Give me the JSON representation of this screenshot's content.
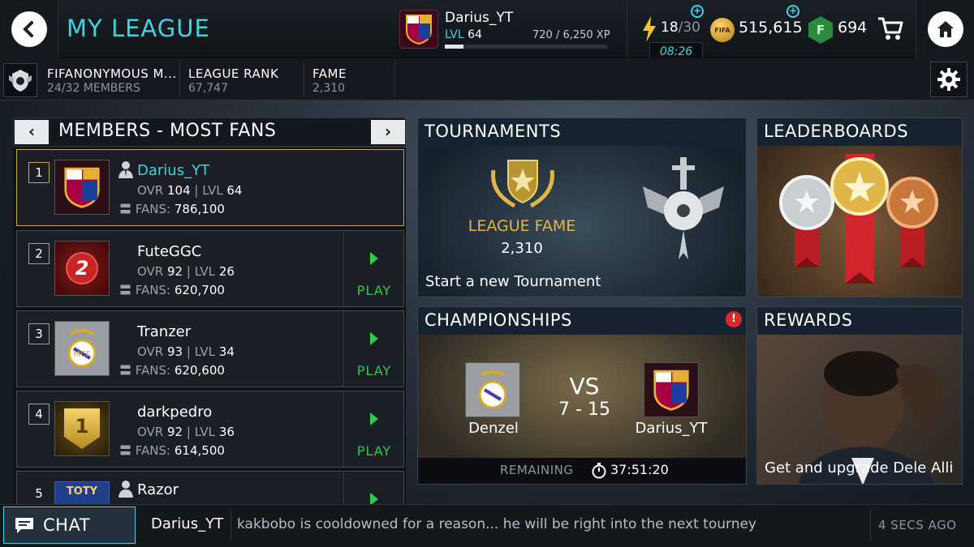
{
  "header": {
    "title": "MY LEAGUE",
    "profile": {
      "name": "Darius_YT",
      "level_label": "LVL",
      "level": "64",
      "xp": "720 / 6,250 XP",
      "xp_progress": 0.115
    },
    "energy": {
      "value": "18",
      "max": "/30",
      "timer": "08:26"
    },
    "coins": "515,615",
    "coin_icon_text": "FIFA",
    "points_icon_text": "F",
    "points": "694",
    "icons": [
      "back-icon",
      "bolt-icon",
      "coin-icon",
      "fifa-points-icon",
      "cart-icon",
      "home-icon",
      "plus-icon"
    ]
  },
  "league": {
    "name": "FIFANONYMOUS M...",
    "members": "24/32 MEMBERS",
    "rank_label": "LEAGUE RANK",
    "rank": "67,747",
    "fame_label": "FAME",
    "fame": "2,310"
  },
  "members_panel": {
    "title": "MEMBERS - MOST FANS",
    "prev": "‹",
    "next": "›",
    "ovr_label": "OVR",
    "lvl_label": "LVL",
    "fans_label": "FANS:",
    "play_label": "PLAY",
    "members": [
      {
        "rank": "1",
        "name": "Darius_YT",
        "ovr": "104",
        "lvl": "64",
        "fans": "786,100",
        "is_self": true
      },
      {
        "rank": "2",
        "name": "FuteGGC",
        "ovr": "92",
        "lvl": "26",
        "fans": "620,700",
        "badge_text": "2"
      },
      {
        "rank": "3",
        "name": "Tranzer",
        "ovr": "93",
        "lvl": "34",
        "fans": "620,600"
      },
      {
        "rank": "4",
        "name": "darkpedro",
        "ovr": "92",
        "lvl": "36",
        "fans": "614,500",
        "badge_text": "1"
      },
      {
        "rank": "5",
        "name": "Razor",
        "badge_text": "TOTY"
      }
    ]
  },
  "tournaments": {
    "title": "TOURNAMENTS",
    "fame_title": "LEAGUE FAME",
    "fame_value": "2,310",
    "footer": "Start a new Tournament"
  },
  "leaderboards": {
    "title": "LEADERBOARDS"
  },
  "championships": {
    "title": "CHAMPIONSHIPS",
    "alert": "!",
    "vs": "VS",
    "score": "7 - 15",
    "home": "Denzel",
    "away": "Darius_YT",
    "remaining_label": "REMAINING",
    "remaining_time": "37:51:20"
  },
  "rewards": {
    "title": "REWARDS",
    "footer": "Get and upgrade Dele Alli"
  },
  "chat": {
    "label": "CHAT",
    "user": "Darius_YT",
    "message": "kakbobo is cooldowned for a reason... he will be right into the next tourney",
    "time": "4 SECS AGO"
  },
  "colors": {
    "accent": "#3fd3e0",
    "play": "#34c94a",
    "gold": "#e0b648",
    "alert": "#d42a2a"
  }
}
